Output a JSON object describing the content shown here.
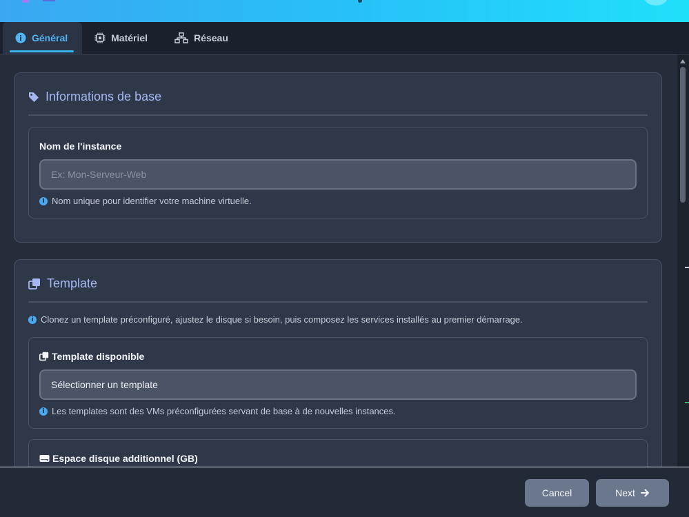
{
  "tabs": [
    {
      "label": "Général",
      "icon": "info-circle-icon",
      "active": true
    },
    {
      "label": "Matériel",
      "icon": "chip-icon",
      "active": false
    },
    {
      "label": "Réseau",
      "icon": "network-icon",
      "active": false
    }
  ],
  "sections": {
    "basic": {
      "title": "Informations de base",
      "icon": "tag-icon",
      "instance_name": {
        "label": "Nom de l'instance",
        "placeholder": "Ex: Mon-Serveur-Web",
        "value": "",
        "hint": "Nom unique pour identifier votre machine virtuelle."
      }
    },
    "template": {
      "title": "Template",
      "icon": "clone-icon",
      "description": "Clonez un template préconfiguré, ajustez le disque si besoin, puis composez les services installés au premier démarrage.",
      "template_select": {
        "label": "Template disponible",
        "selected": "Sélectionner un template",
        "hint": "Les templates sont des VMs préconfigurées servant de base à de nouvelles instances."
      },
      "disk": {
        "label": "Espace disque additionnel (GB)",
        "icon": "hdd-icon"
      }
    }
  },
  "footer": {
    "cancel_label": "Cancel",
    "next_label": "Next"
  },
  "colors": {
    "accent": "#38b6f2",
    "title": "#a6b6f2",
    "button": "#6a778c"
  }
}
